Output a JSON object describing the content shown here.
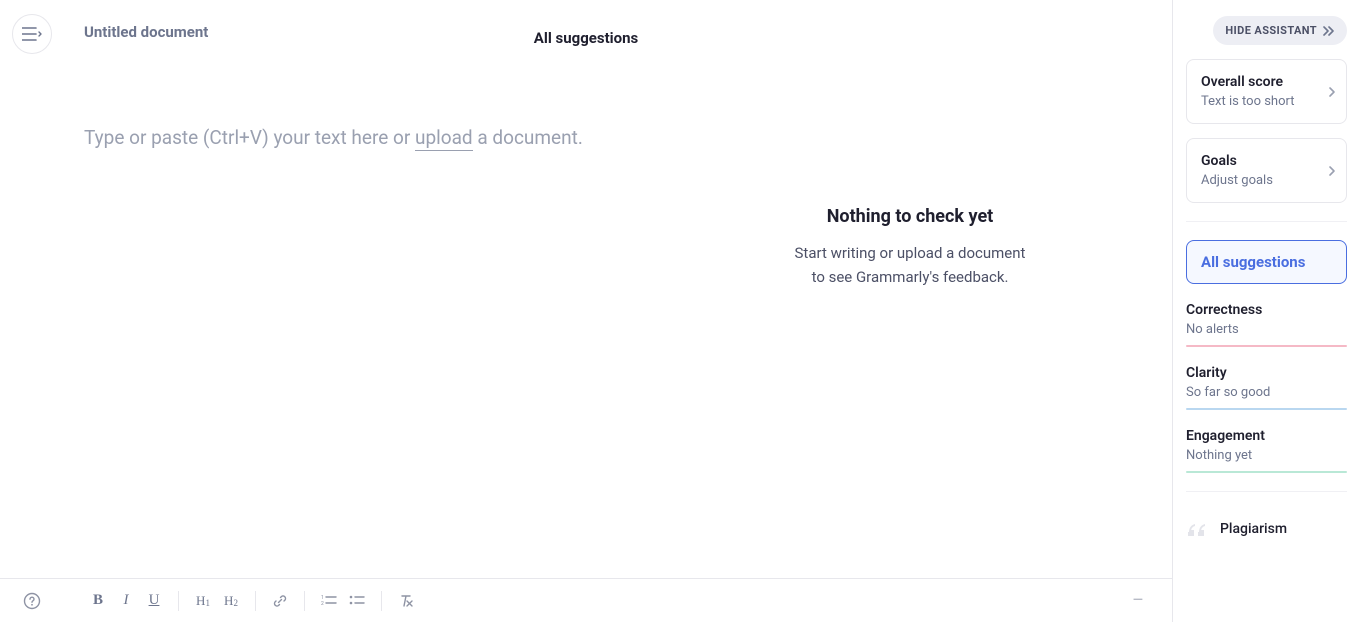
{
  "header": {
    "doc_title": "Untitled document",
    "all_suggestions": "All suggestions"
  },
  "editor": {
    "placeholder_prefix": "Type or paste (Ctrl+V) your text here or ",
    "upload_word": "upload",
    "placeholder_suffix": " a document."
  },
  "feedback": {
    "nothing_title": "Nothing to check yet",
    "nothing_line1": "Start writing or upload a document",
    "nothing_line2": "to see Grammarly's feedback."
  },
  "toolbar": {
    "bold": "B",
    "italic": "I",
    "underline": "U",
    "h1": "H",
    "h1_sub": "1",
    "h2": "H",
    "h2_sub": "2",
    "minus": "–"
  },
  "assistant": {
    "hide_label": "HIDE ASSISTANT",
    "score": {
      "title": "Overall score",
      "sub": "Text is too short"
    },
    "goals": {
      "title": "Goals",
      "sub": "Adjust goals"
    },
    "active_cat": "All suggestions",
    "cats": [
      {
        "title": "Correctness",
        "sub": "No alerts",
        "color": "#f5b9c6"
      },
      {
        "title": "Clarity",
        "sub": "So far so good",
        "color": "#b9d7f0"
      },
      {
        "title": "Engagement",
        "sub": "Nothing yet",
        "color": "#b9e8d6"
      }
    ],
    "plagiarism": "Plagiarism"
  }
}
